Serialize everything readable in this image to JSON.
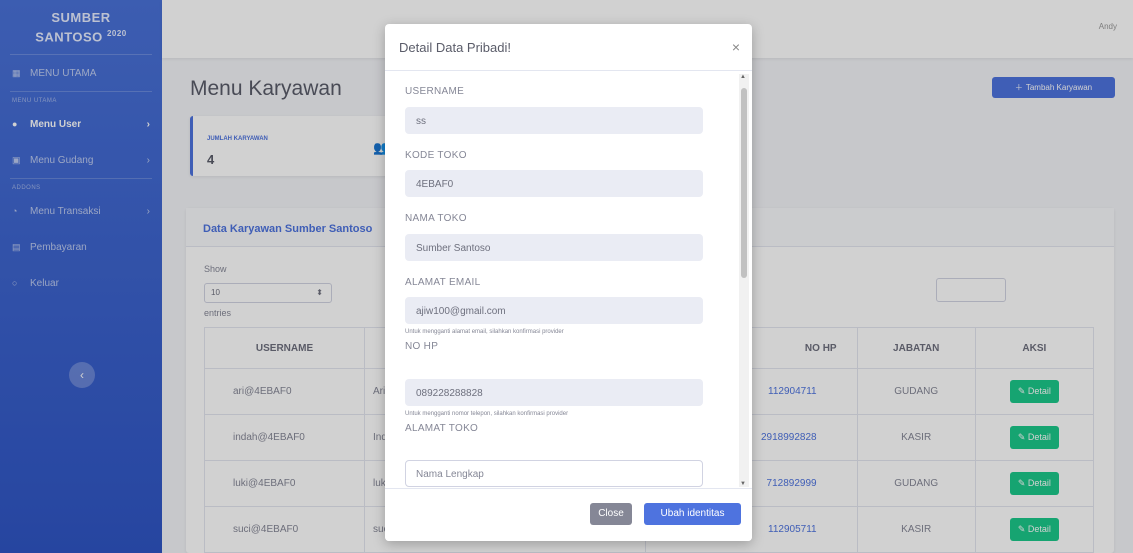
{
  "brand": {
    "name": "SUMBER SANTOSO",
    "year": "2020"
  },
  "sidebar": {
    "items": [
      {
        "label": "MENU UTAMA",
        "icon": "dashboard-icon"
      },
      {
        "heading": "MENU UTAMA"
      },
      {
        "label": "Menu User",
        "icon": "user-icon",
        "active": true
      },
      {
        "label": "Menu Gudang",
        "icon": "warehouse-icon"
      },
      {
        "heading": "ADDONS"
      },
      {
        "label": "Menu Transaksi",
        "icon": "cart-icon"
      },
      {
        "label": "Pembayaran",
        "icon": "payment-icon"
      },
      {
        "label": "Keluar",
        "icon": "logout-icon"
      }
    ],
    "toggle_glyph": "‹"
  },
  "topbar": {
    "user": "Andy"
  },
  "page": {
    "title": "Menu Karyawan",
    "add_button": "Tambah Karyawan",
    "count_label": "JUMLAH KARYAWAN",
    "count_value": "4",
    "card_title": "Data Karyawan Sumber Santoso",
    "show": "Show",
    "entries_value": "10",
    "entries": "entries"
  },
  "table": {
    "headers": [
      "USERNAME",
      "",
      "",
      "",
      "NO HP",
      "JABATAN",
      "AKSI"
    ],
    "rows": [
      {
        "username": "ari@4EBAF0",
        "name": "Ari",
        "phone": "112904711",
        "role": "GUDANG",
        "action": "Detail"
      },
      {
        "username": "indah@4EBAF0",
        "name": "Indi",
        "phone": "2918992828",
        "role": "KASIR",
        "action": "Detail"
      },
      {
        "username": "luki@4EBAF0",
        "name": "luki",
        "phone": "712892999",
        "role": "GUDANG",
        "action": "Detail"
      },
      {
        "username": "suci@4EBAF0",
        "name": "suc",
        "phone": "112905711",
        "role": "KASIR",
        "action": "Detail"
      }
    ]
  },
  "modal": {
    "title": "Detail Data Pribadi!",
    "close_glyph": "×",
    "fields": {
      "username_label": "USERNAME",
      "username_value": "ss",
      "kode_label": "KODE TOKO",
      "kode_value": "4EBAF0",
      "nama_label": "NAMA TOKO",
      "nama_value": "Sumber Santoso",
      "email_label": "ALAMAT EMAIL",
      "email_value": "ajiw100@gmail.com",
      "email_help": "Untuk mengganti alamat email, silahkan konfirmasi provider",
      "hp_label": "NO HP",
      "hp_value": "089228288828",
      "hp_help": "Untuk mengganti nomor telepon, silahkan konfirmasi provider",
      "alamat_label": "ALAMAT TOKO",
      "alamat_placeholder": "Nama Lengkap"
    },
    "close_button": "Close",
    "save_button": "Ubah identitas"
  }
}
